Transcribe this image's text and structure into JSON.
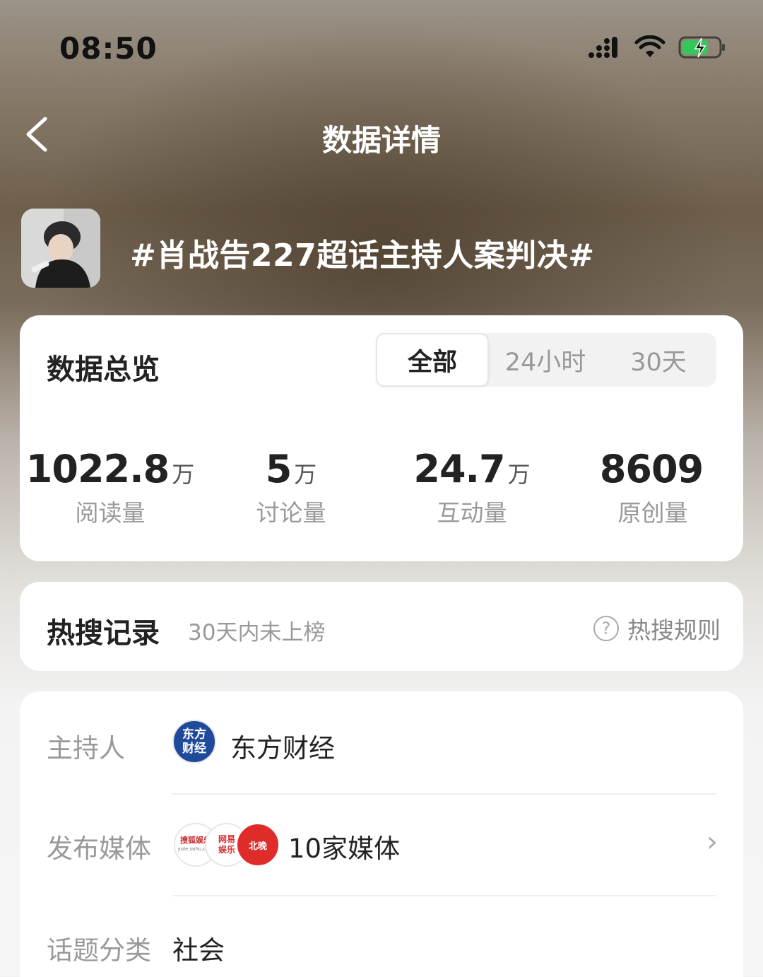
{
  "status_bar": {
    "time": "08:50"
  },
  "nav": {
    "title": "数据详情"
  },
  "topic": {
    "title": "#肖战告227超话主持人案判决#"
  },
  "overview": {
    "title": "数据总览",
    "tabs": [
      {
        "label": "全部",
        "active": true
      },
      {
        "label": "24小时",
        "active": false
      },
      {
        "label": "30天",
        "active": false
      }
    ],
    "stats": [
      {
        "value": "1022.8",
        "unit": "万",
        "label": "阅读量"
      },
      {
        "value": "5",
        "unit": "万",
        "label": "讨论量"
      },
      {
        "value": "24.7",
        "unit": "万",
        "label": "互动量"
      },
      {
        "value": "8609",
        "unit": "",
        "label": "原创量"
      }
    ]
  },
  "hot_search": {
    "title": "热搜记录",
    "subtitle": "30天内未上榜",
    "rule_label": "热搜规则"
  },
  "info": {
    "host": {
      "label": "主持人",
      "logo_text": "东方财经",
      "name": "东方财经"
    },
    "media": {
      "label": "发布媒体",
      "logos": [
        "搜狐娱乐",
        "网易娱乐",
        "北晚"
      ],
      "logo_sub": "yule.sohu.com",
      "value": "10家媒体"
    },
    "category": {
      "label": "话题分类",
      "value": "社会"
    }
  },
  "colors": {
    "accent_red": "#e02b2b",
    "host_logo_blue": "#1f4a9c",
    "text_primary": "#222222",
    "text_secondary": "#999999"
  }
}
